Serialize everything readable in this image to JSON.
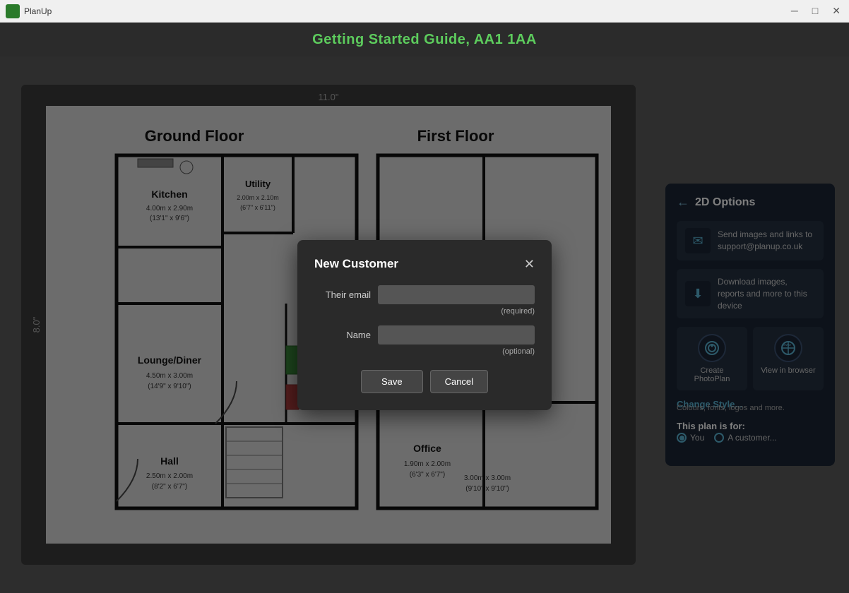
{
  "titlebar": {
    "app_name": "PlanUp",
    "minimize_label": "─",
    "maximize_label": "□",
    "close_label": "✕"
  },
  "header": {
    "title": "Getting Started Guide, AA1 1AA"
  },
  "floorplan": {
    "dimension_top": "11.0\"",
    "dimension_left": "8.0\"",
    "ground_floor_label": "Ground Floor",
    "first_floor_label": "First Floor",
    "rooms": [
      {
        "name": "Kitchen",
        "dim1": "4.00m x 2.90m",
        "dim2": "(13'1\" x 9'6\")"
      },
      {
        "name": "Utility",
        "dim1": "2.00m x 2.10m",
        "dim2": "(6'7\" x 6'11\")"
      },
      {
        "name": "Lounge/Diner",
        "dim1": "4.50m x 3.00m",
        "dim2": "(14'9\" x 9'10\")"
      },
      {
        "name": "Hall",
        "dim1": "2.50m x 2.00m",
        "dim2": "(8'2\" x 6'7\")"
      },
      {
        "name": "Office",
        "dim1": "1.90m x 2.00m",
        "dim2": "(6'3\" x 6'7\")"
      },
      {
        "name": "3.00m x 3.00m",
        "dim1": "",
        "dim2": "(9'10\" x 9'10\")"
      }
    ]
  },
  "right_panel": {
    "title": "2D Options",
    "back_icon": "←",
    "options": [
      {
        "icon": "✉",
        "text": "Send images and links to support@planup.co.uk"
      },
      {
        "icon": "⬇",
        "text": "Download images, reports and more to this device"
      }
    ],
    "grid_items": [
      {
        "icon": "📷",
        "label": "Create PhotoPlan"
      },
      {
        "icon": "🌐",
        "label": "View in browser"
      }
    ],
    "change_style_label": "Change Style...",
    "change_style_sub": "Colours, fonts, logos and more.",
    "plan_for_label": "This plan is for:",
    "radio_options": [
      {
        "label": "You",
        "selected": true
      },
      {
        "label": "A customer...",
        "selected": false
      }
    ]
  },
  "modal": {
    "title": "New Customer",
    "close_icon": "✕",
    "fields": [
      {
        "label": "Their email",
        "placeholder": "",
        "hint": "(required)",
        "type": "email"
      },
      {
        "label": "Name",
        "placeholder": "",
        "hint": "(optional)",
        "type": "text"
      }
    ],
    "save_label": "Save",
    "cancel_label": "Cancel"
  }
}
